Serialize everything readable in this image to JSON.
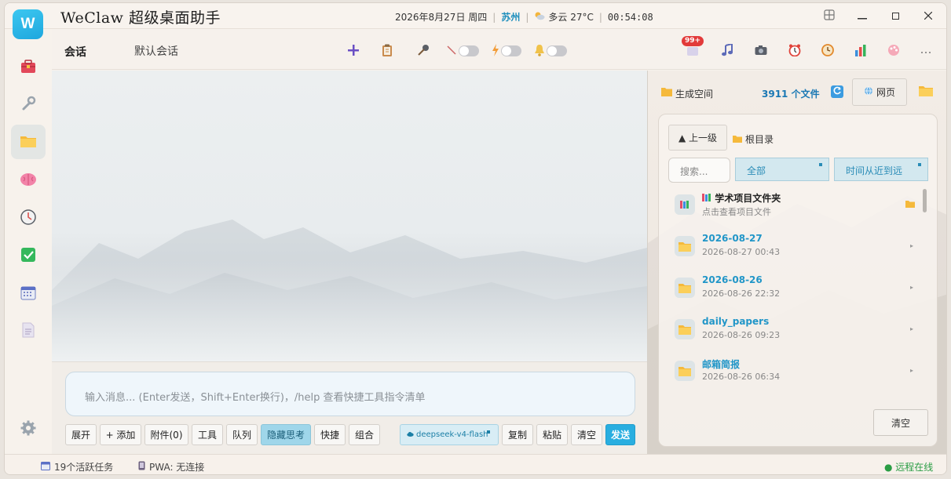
{
  "app": {
    "title": "WeClaw 超级桌面助手",
    "logo_letter": "W",
    "date": "2026年8月27日 周四",
    "city": "苏州",
    "weather": "多云 27°C",
    "clock": "00:54:08"
  },
  "window_controls": {
    "layout_icon": "grid-icon",
    "minimize": "—",
    "maximize": "☐",
    "close": "✕"
  },
  "sidebar": {
    "items": [
      {
        "icon": "toolbox-icon"
      },
      {
        "icon": "wrench-icon"
      },
      {
        "icon": "folder-icon",
        "active": true
      },
      {
        "icon": "brain-icon"
      },
      {
        "icon": "clock-icon"
      },
      {
        "icon": "checkbox-icon"
      },
      {
        "icon": "calendar-icon"
      },
      {
        "icon": "document-icon"
      }
    ],
    "settings_icon": "gear-icon"
  },
  "toolbar": {
    "tab_session": "会话",
    "tab_default": "默认会话",
    "badge": "99+"
  },
  "chat": {
    "input_placeholder": "输入消息... (Enter发送，Shift+Enter换行)，/help 查看快捷工具指令清单",
    "buttons": {
      "expand": "展开",
      "add": "+ 添加",
      "attach": "附件(0)",
      "tools": "工具",
      "queue": "队列",
      "hide_think": "隐藏思考",
      "quick": "快捷",
      "combo": "组合",
      "model": "deepseek-v4-flash",
      "copy": "复制",
      "paste": "粘贴",
      "clear": "清空",
      "send": "发送"
    }
  },
  "files": {
    "title": "生成空间",
    "count": "3911 个文件",
    "web_label": "网页",
    "up_label": "▲ 上一级",
    "root_label": "根目录",
    "search_placeholder": "搜索...",
    "filter_all": "全部",
    "sort": "时间从近到远",
    "items": [
      {
        "name": "学术项目文件夹",
        "sub": "点击查看项目文件"
      },
      {
        "name": "2026-08-27",
        "sub": "2026-08-27 00:43"
      },
      {
        "name": "2026-08-26",
        "sub": "2026-08-26 22:32"
      },
      {
        "name": "daily_papers",
        "sub": "2026-08-26 09:23"
      },
      {
        "name": "邮箱简报",
        "sub": "2026-08-26 06:34"
      }
    ],
    "clear_label": "清空"
  },
  "statusbar": {
    "tasks": "19个活跃任务",
    "pwa": "PWA: 无连接",
    "online": "● 远程在线"
  }
}
